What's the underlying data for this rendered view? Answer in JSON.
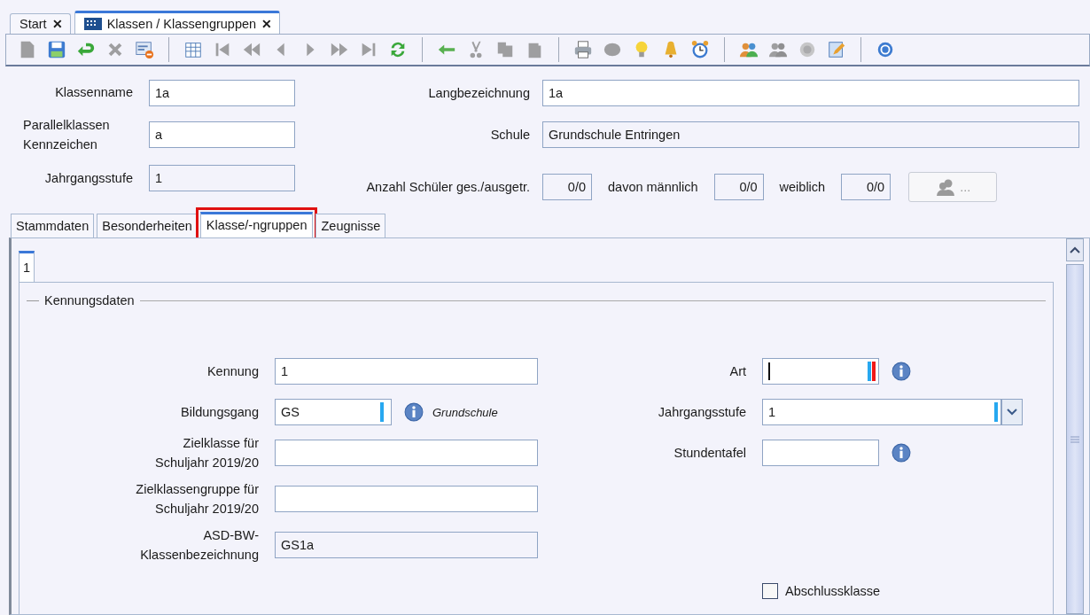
{
  "doc_tabs": [
    {
      "label": "Start",
      "kind": "plain",
      "selected": false,
      "close": "✕"
    },
    {
      "label": "Klassen / Klassengruppen",
      "kind": "with-icon",
      "selected": true,
      "close": "✕"
    }
  ],
  "toolbar": [
    [
      {
        "kind": "document",
        "disabled": true
      },
      {
        "kind": "save",
        "disabled": false
      },
      {
        "kind": "undo",
        "disabled": false
      },
      {
        "kind": "delete",
        "disabled": true
      },
      {
        "kind": "form-remove",
        "disabled": false
      }
    ],
    [
      {
        "kind": "table",
        "disabled": false
      },
      {
        "kind": "first",
        "disabled": true
      },
      {
        "kind": "fast-back",
        "disabled": true
      },
      {
        "kind": "back",
        "disabled": true
      },
      {
        "kind": "forward",
        "disabled": true
      },
      {
        "kind": "fast-forward",
        "disabled": true
      },
      {
        "kind": "last",
        "disabled": true
      },
      {
        "kind": "refresh",
        "disabled": false
      }
    ],
    [
      {
        "kind": "arrow-left",
        "disabled": false
      },
      {
        "kind": "cut",
        "disabled": true
      },
      {
        "kind": "copy",
        "disabled": true
      },
      {
        "kind": "paste",
        "disabled": true
      }
    ],
    [
      {
        "kind": "print",
        "disabled": false
      },
      {
        "kind": "disc",
        "disabled": true
      },
      {
        "kind": "bulb",
        "disabled": false
      },
      {
        "kind": "bell",
        "disabled": false
      },
      {
        "kind": "alarm",
        "disabled": false
      }
    ],
    [
      {
        "kind": "people",
        "disabled": false
      },
      {
        "kind": "people",
        "disabled": true
      },
      {
        "kind": "coin",
        "disabled": true
      },
      {
        "kind": "edit",
        "disabled": false
      }
    ],
    [
      {
        "kind": "help",
        "disabled": false
      }
    ]
  ],
  "header": {
    "klassenname": {
      "label": "Klassenname",
      "value": "1a",
      "readonly": false
    },
    "langbezeichnung": {
      "label": "Langbezeichnung",
      "value": "1a",
      "readonly": false
    },
    "parallel": {
      "label": "Parallelklassen\nKennzeichen",
      "value": "a",
      "readonly": false
    },
    "schule": {
      "label": "Schule",
      "value": "Grundschule Entringen",
      "readonly": true
    },
    "jahrgang": {
      "label": "Jahrgangsstufe",
      "value": "1",
      "readonly": true
    },
    "anzahl": {
      "label": "Anzahl Schüler ges./ausgetr.",
      "value": "0/0",
      "readonly": true
    },
    "maennlich": {
      "label": "davon männlich",
      "value": "0/0",
      "readonly": true
    },
    "weiblich": {
      "label": "weiblich",
      "value": "0/0",
      "readonly": true
    },
    "students_button": {
      "label": "...",
      "disabled": true
    }
  },
  "tabs": [
    {
      "label": "Stammdaten",
      "selected": false,
      "highlighted": false
    },
    {
      "label": "Besonderheiten",
      "selected": false,
      "highlighted": false
    },
    {
      "label": "Klasse/-ngruppen",
      "selected": true,
      "highlighted": true
    },
    {
      "label": "Zeugnisse",
      "selected": false,
      "highlighted": false
    }
  ],
  "subtabs": [
    {
      "label": "1",
      "selected": true
    }
  ],
  "group": {
    "title": "Kennungsdaten",
    "left": [
      {
        "kind": "text",
        "label": "Kennung",
        "value": "1",
        "readonly": false
      },
      {
        "kind": "code",
        "label": "Bildungsgang",
        "value": "GS",
        "readonly": false,
        "required": true,
        "error": false,
        "focused": false,
        "note": "Grundschule"
      },
      {
        "kind": "text",
        "label": "Zielklasse für\nSchuljahr 2019/20",
        "readonly": false
      },
      {
        "kind": "text",
        "label": "Zielklassengruppe für\nSchuljahr 2019/20",
        "readonly": false
      },
      {
        "kind": "text",
        "label": "ASD-BW-\nKlassenbezeichnung",
        "value": "GS1a",
        "readonly": true
      }
    ],
    "right": [
      {
        "kind": "code",
        "label": "Art",
        "readonly": false,
        "required": true,
        "error": true,
        "focused": true
      },
      {
        "kind": "dropdown",
        "label": "Jahrgangsstufe",
        "value": "1",
        "readonly": false,
        "required": true
      },
      {
        "kind": "code",
        "label": "Stundentafel",
        "readonly": false,
        "required": false,
        "error": false,
        "focused": false
      },
      {
        "kind": "spacer"
      },
      {
        "kind": "checkbox",
        "label": "Abschlussklasse",
        "checked": false
      }
    ]
  }
}
